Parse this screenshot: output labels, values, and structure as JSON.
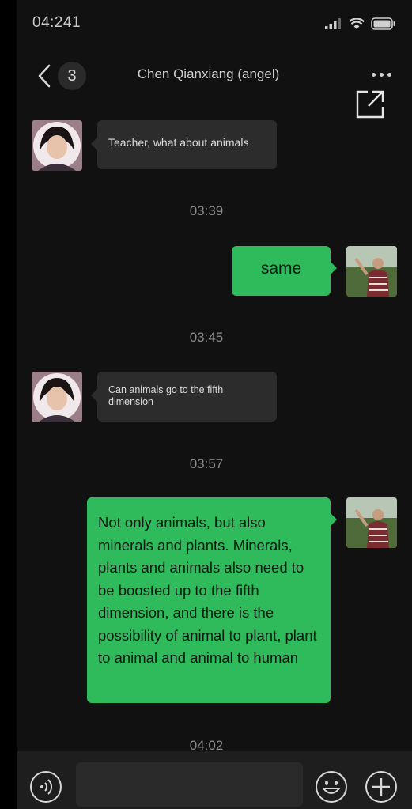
{
  "status_bar": {
    "time": "04:241",
    "icons": [
      "signal-icon",
      "wifi-icon",
      "battery-icon"
    ]
  },
  "nav": {
    "back_icon": "chevron-left-icon",
    "unread_count": "3",
    "title": "Chen Qianxiang (angel)",
    "more_icon": "more-dots-icon",
    "external_icon": "open-external-icon"
  },
  "messages": [
    {
      "type": "incoming",
      "sender": "Chen Qianxiang (angel)",
      "text": "Teacher, what about animals"
    },
    {
      "type": "timestamp",
      "text": "03:39"
    },
    {
      "type": "outgoing",
      "text": "same"
    },
    {
      "type": "timestamp",
      "text": "03:45"
    },
    {
      "type": "incoming",
      "sender": "Chen Qianxiang (angel)",
      "text": "Can animals go to the fifth dimension"
    },
    {
      "type": "timestamp",
      "text": "03:57"
    },
    {
      "type": "outgoing",
      "text": "Not only animals, but also minerals and plants. Minerals, plants and animals also need to be boosted up to the fifth dimension, and there is the possibility of animal to plant, plant to animal and animal to human"
    },
    {
      "type": "timestamp",
      "text": "04:02"
    }
  ],
  "input_bar": {
    "voice_icon": "voice-icon",
    "placeholder": "",
    "emoji_icon": "emoji-icon",
    "plus_icon": "plus-icon"
  },
  "colors": {
    "background": "#111111",
    "outgoing_bubble": "#2fba5c",
    "incoming_bubble": "#2c2c2c"
  }
}
